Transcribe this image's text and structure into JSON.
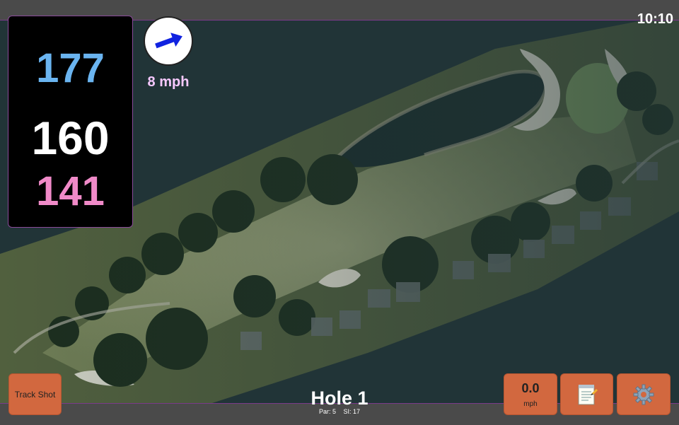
{
  "status": {
    "clock": "10:10"
  },
  "distances": {
    "back": "177",
    "middle": "160",
    "front": "141"
  },
  "wind": {
    "speed": "8 mph",
    "icon": "wind-direction-arrow-icon"
  },
  "hole": {
    "title": "Hole 1",
    "par": "Par: 5",
    "si": "SI: 17"
  },
  "buttons": {
    "track_shot": "Track Shot",
    "speed_value": "0.0",
    "speed_unit": "mph",
    "notes_icon": "notepad-icon",
    "settings_icon": "gear-icon"
  },
  "colors": {
    "back_distance": "#6ab4f0",
    "middle_distance": "#ffffff",
    "front_distance": "#f08ac8",
    "wind_text": "#f6c8ff",
    "button": "#d2683f",
    "accent_line": "#7a3a8a"
  }
}
